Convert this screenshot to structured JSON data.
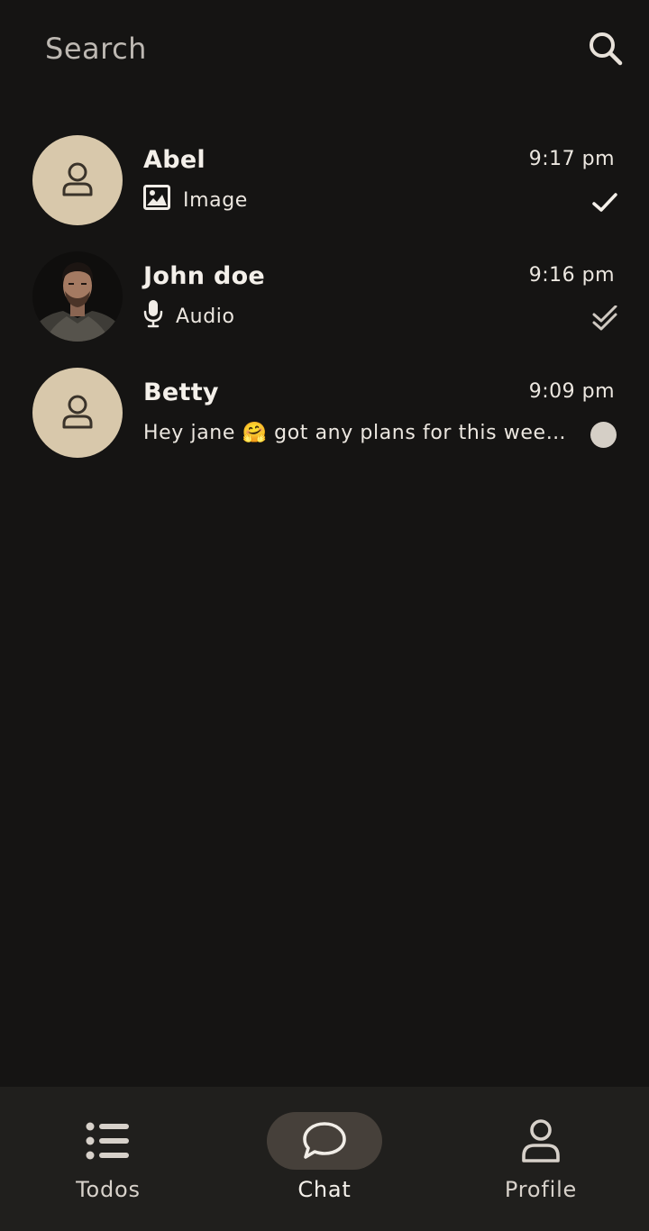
{
  "search": {
    "placeholder": "Search",
    "icon": "search-icon"
  },
  "chats": [
    {
      "name": "Abel",
      "time": "9:17 pm",
      "avatar": "default-person-avatar",
      "preview_icon": "image-icon",
      "preview": "Image",
      "status": "sent-check-icon"
    },
    {
      "name": "John doe",
      "time": "9:16 pm",
      "avatar": "photo-avatar",
      "preview_icon": "microphone-icon",
      "preview": "Audio",
      "status": "delivered-double-check-icon"
    },
    {
      "name": "Betty",
      "time": "9:09 pm",
      "avatar": "default-person-avatar",
      "preview_icon": "",
      "preview": "Hey jane 🤗 got any plans for this weekend?",
      "status": "unread-dot"
    }
  ],
  "nav": {
    "items": [
      {
        "label": "Todos",
        "icon": "list-icon"
      },
      {
        "label": "Chat",
        "icon": "chat-bubble-icon",
        "active": true
      },
      {
        "label": "Profile",
        "icon": "person-icon"
      }
    ]
  },
  "colors": {
    "background": "#151413",
    "nav_background": "#201f1d",
    "avatar_placeholder": "#d8c8ab",
    "active_pill": "#46403a",
    "text": "#f1ede7",
    "muted_text": "#bdb8b2"
  }
}
